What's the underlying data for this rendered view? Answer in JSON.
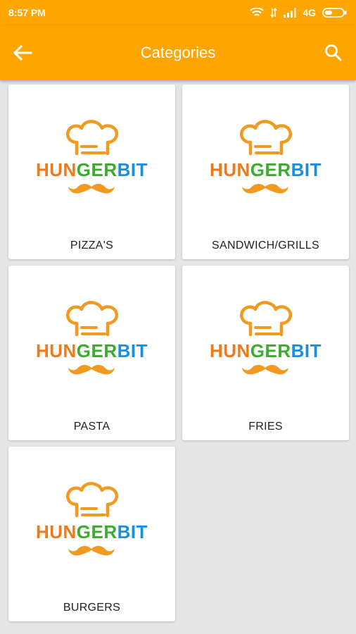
{
  "status_bar": {
    "time": "8:57 PM",
    "network": "4G"
  },
  "app_bar": {
    "title": "Categories",
    "back_icon": "arrow-left-icon",
    "search_icon": "search-icon"
  },
  "brand": {
    "part1": "HUN",
    "part2": "GER",
    "part3": "BIT",
    "colors": {
      "orange": "#f07a1a",
      "green": "#3cab2e",
      "blue": "#1a8fe0",
      "accent": "#ffa500"
    }
  },
  "categories": [
    {
      "label": "PIZZA'S"
    },
    {
      "label": "SANDWICH/GRILLS"
    },
    {
      "label": "PASTA"
    },
    {
      "label": "FRIES"
    },
    {
      "label": "BURGERS"
    }
  ]
}
